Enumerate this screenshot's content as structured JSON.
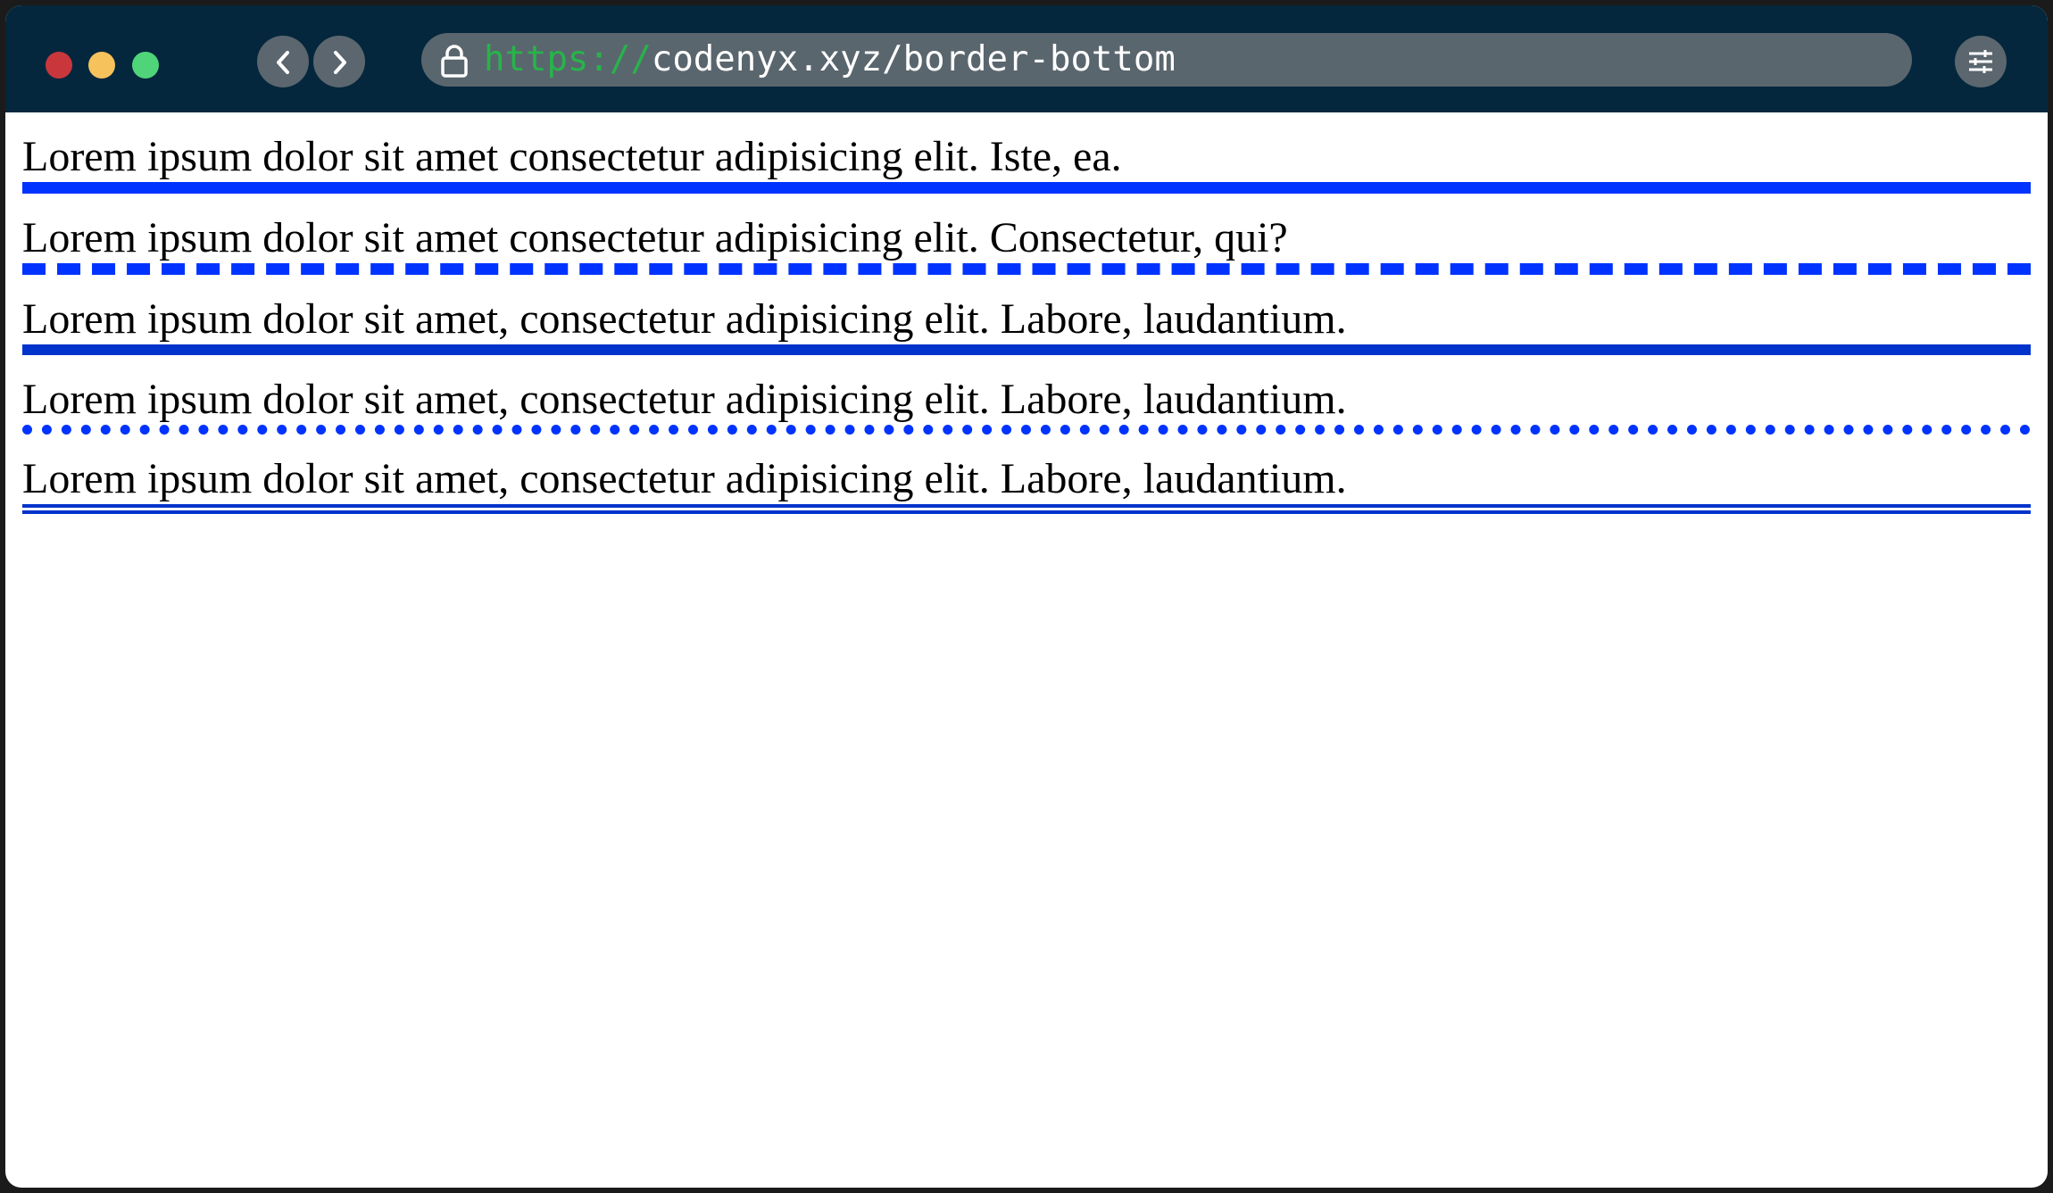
{
  "browser": {
    "url_scheme": "https://",
    "url_rest": "codenyx.xyz/border-bottom",
    "icons": [
      "back-chevron-icon",
      "forward-chevron-icon",
      "lock-icon",
      "settings-sliders-icon"
    ]
  },
  "colors": {
    "titlebar": "#04273d",
    "border_bright": "#0033ff",
    "border_dark": "#0033cc",
    "traffic_red": "#c9373d",
    "traffic_yellow": "#f6c25c",
    "traffic_green": "#4fd47a"
  },
  "paragraphs": [
    {
      "text": "Lorem ipsum dolor sit amet consectetur adipisicing elit. Iste, ea.",
      "border_style": "solid"
    },
    {
      "text": "Lorem ipsum dolor sit amet consectetur adipisicing elit. Consectetur, qui?",
      "border_style": "dashed"
    },
    {
      "text": "Lorem ipsum dolor sit amet, consectetur adipisicing elit. Labore, laudantium.",
      "border_style": "solid"
    },
    {
      "text": "Lorem ipsum dolor sit amet, consectetur adipisicing elit. Labore, laudantium.",
      "border_style": "dotted"
    },
    {
      "text": "Lorem ipsum dolor sit amet, consectetur adipisicing elit. Labore, laudantium.",
      "border_style": "double"
    }
  ]
}
